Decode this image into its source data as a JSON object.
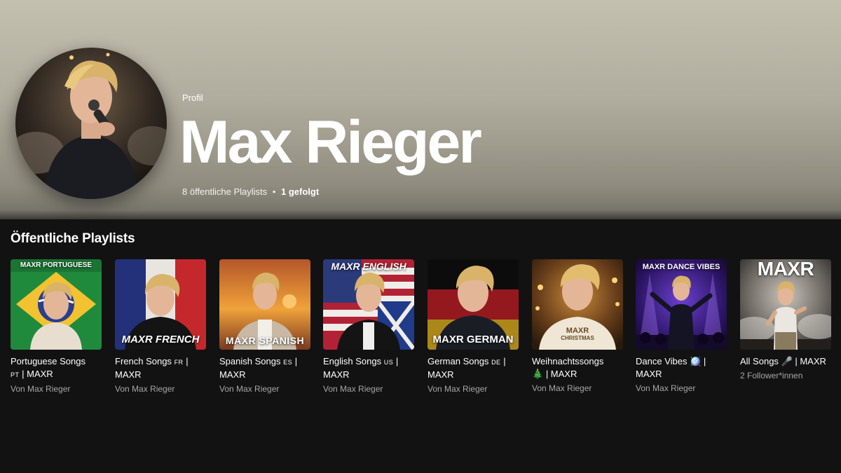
{
  "profile": {
    "label": "Profil",
    "name": "Max Rieger",
    "public_playlists": "8 öffentliche Playlists",
    "separator": "•",
    "following": "1 gefolgt"
  },
  "section": {
    "title": "Öffentliche Playlists"
  },
  "playlists": [
    {
      "cover_text": "MAXR PORTUGUESE",
      "title_a": "Portuguese Songs",
      "tag": "PT",
      "title_b": "| MAXR",
      "subtitle": "Von Max Rieger"
    },
    {
      "cover_text": "MAXR FRENCH",
      "title_a": "French Songs",
      "tag": "FR",
      "title_b": "| MAXR",
      "subtitle": "Von Max Rieger"
    },
    {
      "cover_text": "MAXR SPANISH",
      "title_a": "Spanish Songs",
      "tag": "ES",
      "title_b": "| MAXR",
      "subtitle": "Von Max Rieger"
    },
    {
      "cover_text": "MAXR ENGLISH",
      "title_a": "English Songs",
      "tag": "US",
      "title_b": "| MAXR",
      "subtitle": "Von Max Rieger"
    },
    {
      "cover_text": "MAXR GERMAN",
      "title_a": "German Songs",
      "tag": "DE",
      "title_b": "| MAXR",
      "subtitle": "Von Max Rieger"
    },
    {
      "cover_text": "MAXR",
      "cover_text_2": "CHRISTMAS",
      "title_a": "Weihnachtssongs",
      "tag": "🎄",
      "title_b": "| MAXR",
      "subtitle": "Von Max Rieger"
    },
    {
      "cover_text": "MAXR DANCE VIBES",
      "title_a": "Dance Vibes",
      "tag": "🪩",
      "title_b": "| MAXR",
      "subtitle": "Von Max Rieger"
    },
    {
      "cover_text": "MAXR",
      "title_a": "All Songs",
      "tag": "🎤",
      "title_b": "| MAXR",
      "subtitle": "2 Follower*innen"
    }
  ],
  "colors": {
    "hero_top": "#c4c0b0",
    "hero_bottom": "#6f6c63",
    "page_bg": "#121212",
    "subtext": "#a7a7a7"
  }
}
